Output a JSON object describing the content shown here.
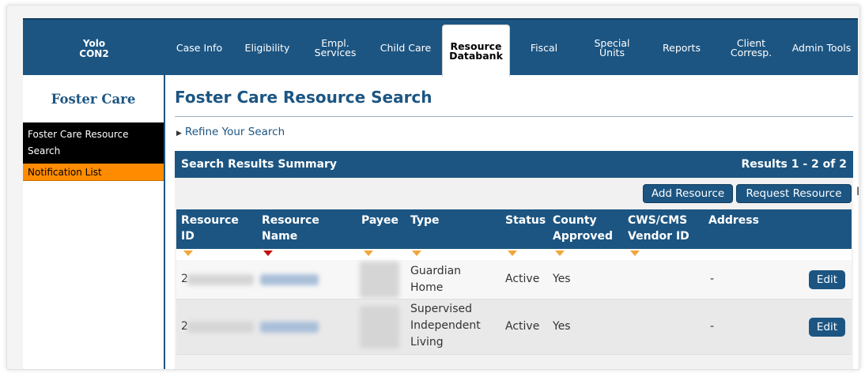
{
  "nav": {
    "county_line1": "Yolo",
    "county_line2": "CON2",
    "items": [
      {
        "label": "Case Info"
      },
      {
        "label": "Eligibility"
      },
      {
        "label": "Empl.\nServices"
      },
      {
        "label": "Child Care"
      },
      {
        "label": "Resource\nDatabank",
        "active": true
      },
      {
        "label": "Fiscal"
      },
      {
        "label": "Special\nUnits"
      },
      {
        "label": "Reports"
      },
      {
        "label": "Client\nCorresp."
      },
      {
        "label": "Admin Tools"
      }
    ]
  },
  "sidebar": {
    "title": "Foster Care",
    "items": [
      {
        "label": "Foster Care Resource Search",
        "active": true
      },
      {
        "label": "Notification List"
      }
    ]
  },
  "main": {
    "title": "Foster Care Resource Search",
    "refine_label": "Refine Your Search",
    "summary_title": "Search Results Summary",
    "results_text": "Results 1 - 2 of 2",
    "add_resource_label": "Add Resource",
    "request_resource_label": "Request Resource",
    "cursor_glyph": "I"
  },
  "table": {
    "headers": {
      "resource_id": "Resource\nID",
      "resource_name": "Resource\nName",
      "payee": "Payee",
      "type": "Type",
      "status": "Status",
      "county_approved": "County\nApproved",
      "cws_cms": "CWS/CMS\nVendor ID",
      "address": "Address"
    },
    "rows": [
      {
        "id_prefix": "2",
        "type": "Guardian\nHome",
        "status": "Active",
        "county_approved": "Yes",
        "address": "-",
        "edit_label": "Edit"
      },
      {
        "id_prefix": "2",
        "type": "Supervised\nIndependent\nLiving",
        "status": "Active",
        "county_approved": "Yes",
        "address": "-",
        "edit_label": "Edit"
      }
    ]
  },
  "colors": {
    "primary": "#1c5582",
    "sidebar_highlight": "#ff8c00",
    "sort_arrow": "#f0a63b",
    "sort_active": "#c21010"
  }
}
